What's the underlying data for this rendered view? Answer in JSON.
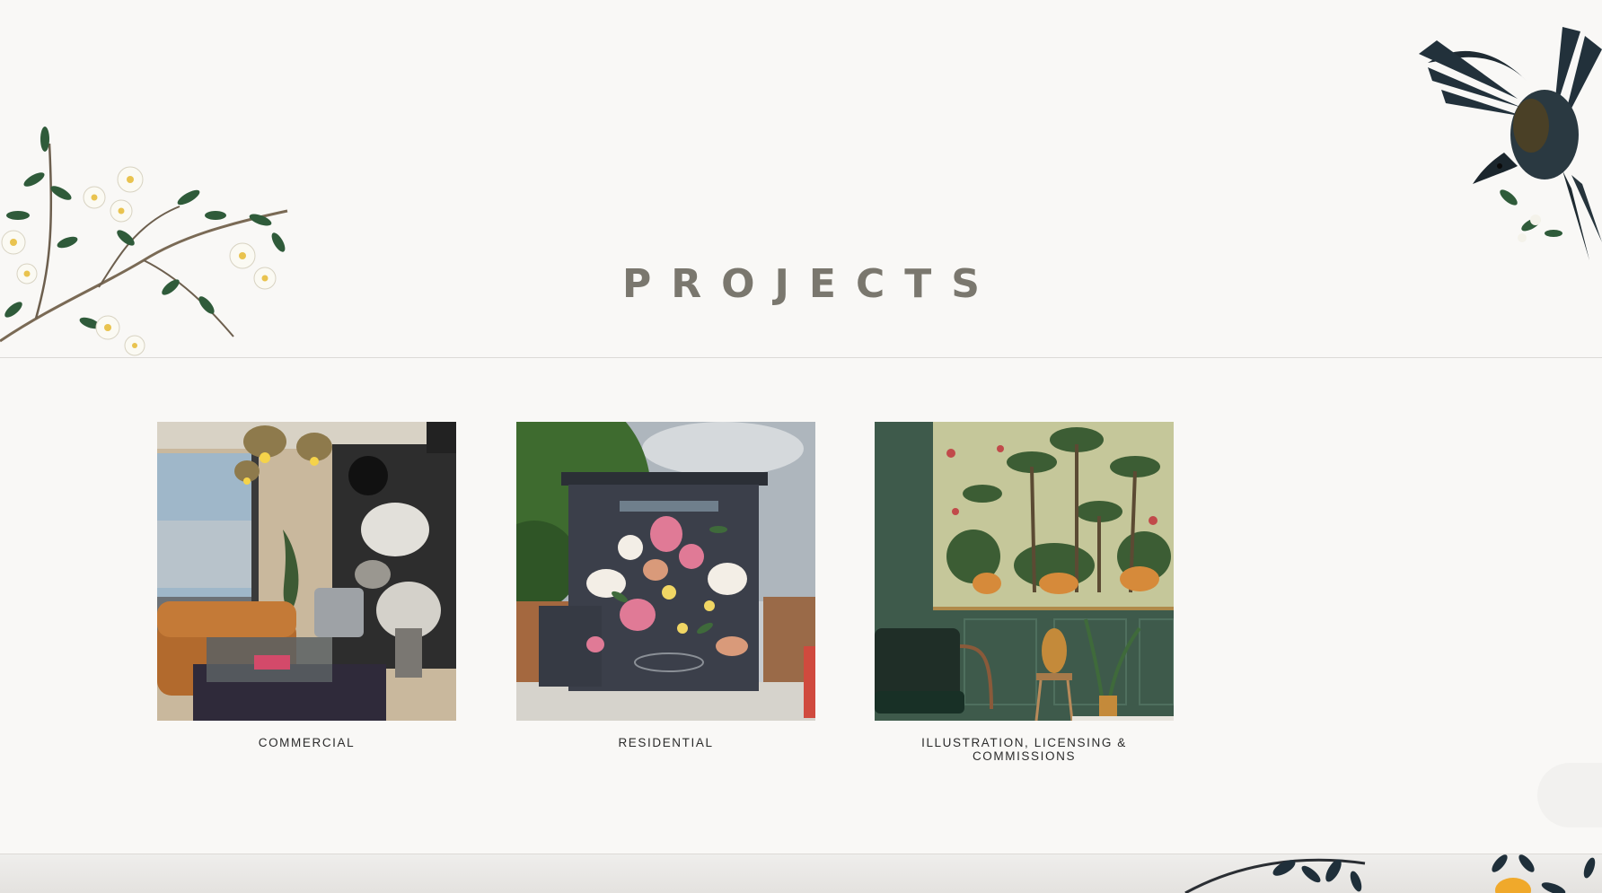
{
  "page": {
    "title": "PROJECTS"
  },
  "projects": [
    {
      "label": "COMMERCIAL"
    },
    {
      "label": "RESIDENTIAL"
    },
    {
      "label": "ILLUSTRATION, LICENSING & COMMISSIONS"
    }
  ],
  "colors": {
    "background": "#f9f8f6",
    "title": "#7a776e",
    "label": "#2b2b2b",
    "divider": "#dcdad6"
  },
  "icons": [
    "floral-branch-decoration",
    "bird-decoration",
    "footer-floral-decoration"
  ]
}
